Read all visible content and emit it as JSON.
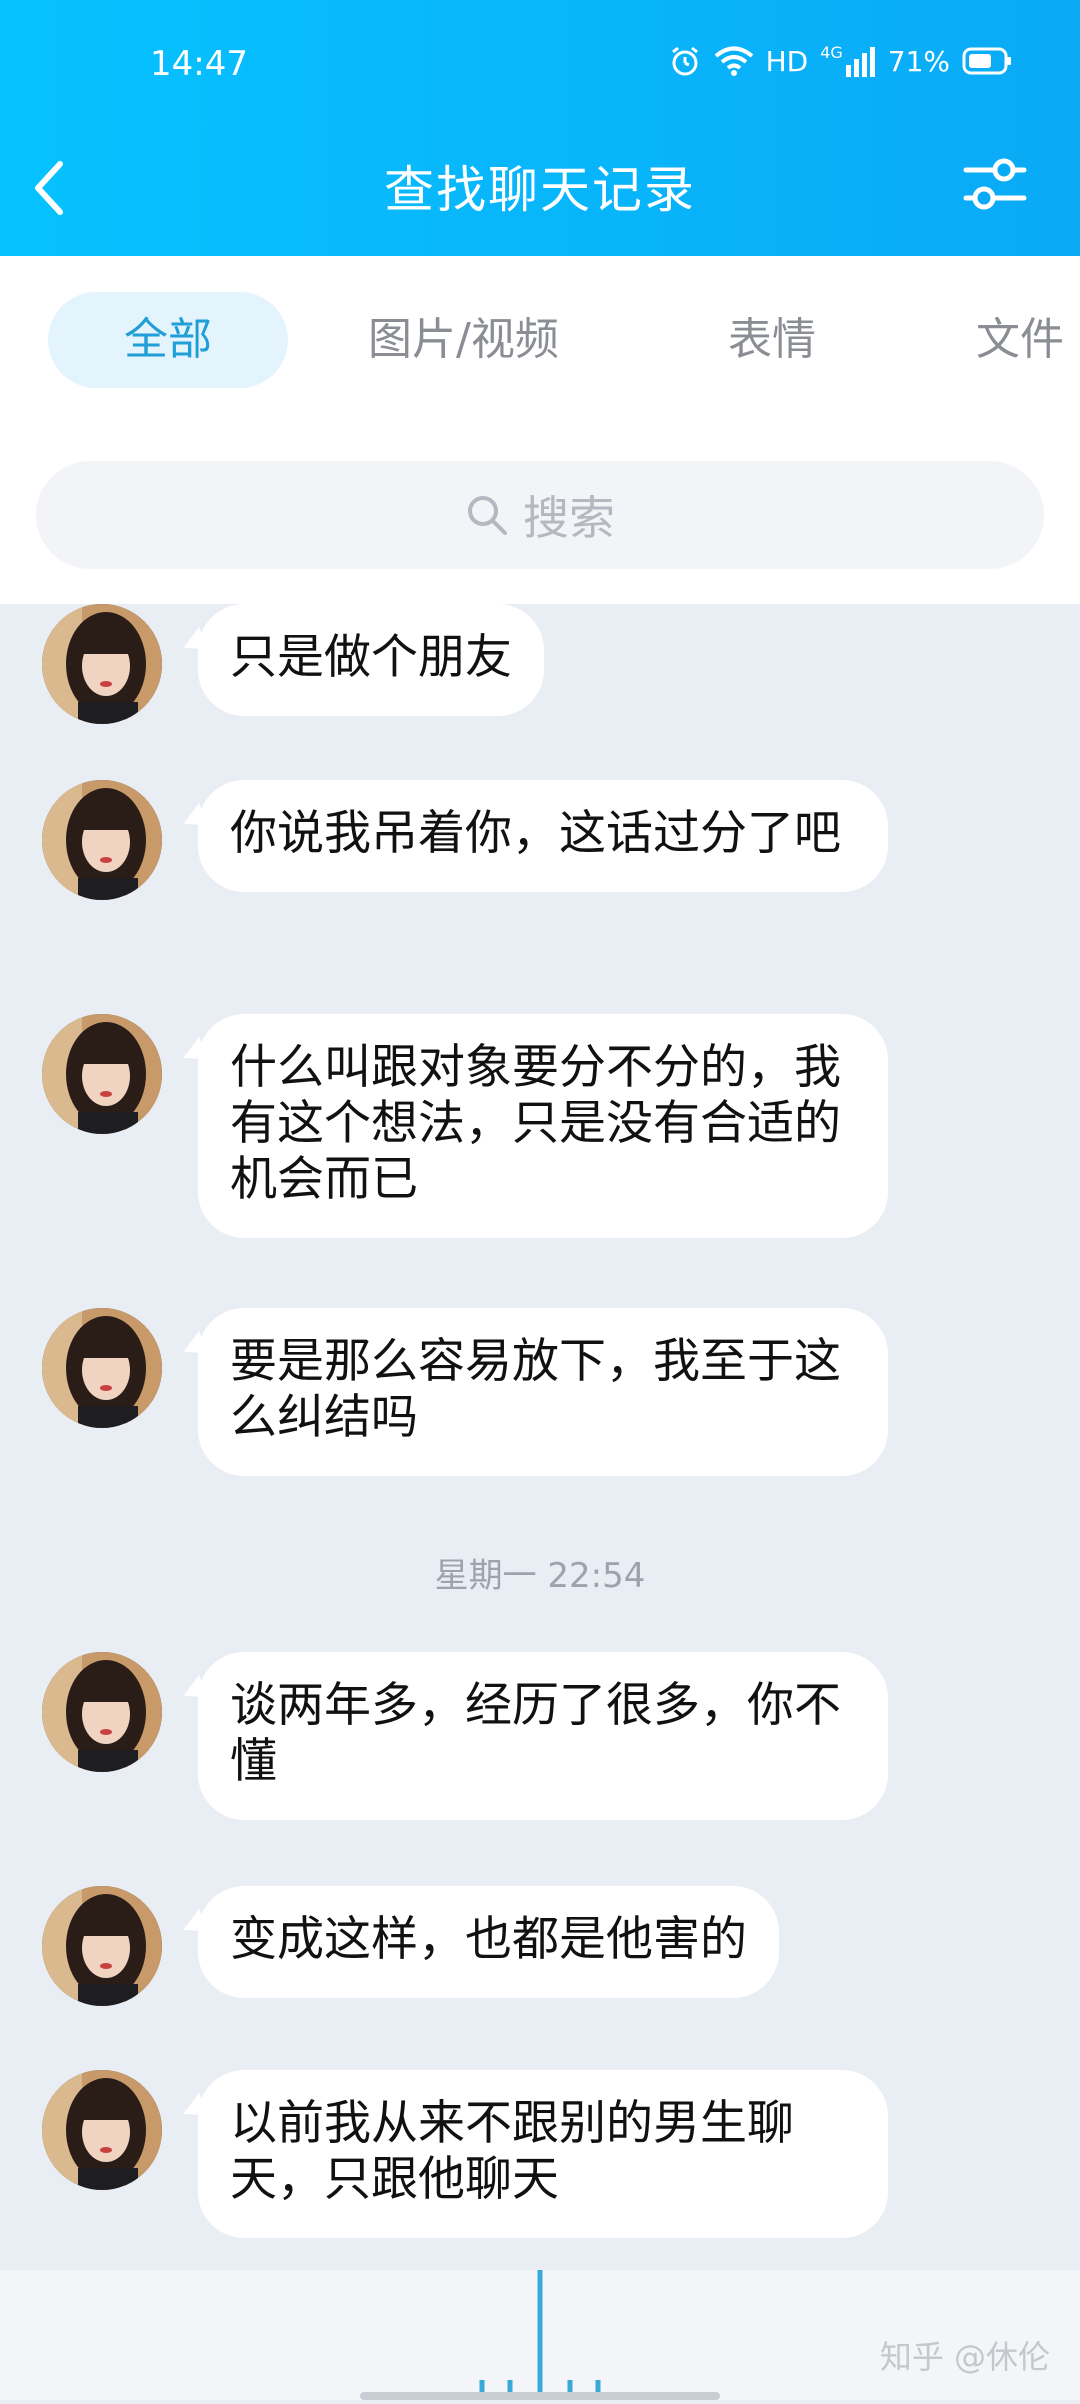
{
  "status_bar": {
    "time": "14:47",
    "hd": "HD",
    "network": "4G",
    "battery": "71%"
  },
  "header": {
    "title": "查找聊天记录"
  },
  "tabs": [
    {
      "label": "全部",
      "active": true
    },
    {
      "label": "图片/视频",
      "active": false
    },
    {
      "label": "表情",
      "active": false
    },
    {
      "label": "文件",
      "active": false
    }
  ],
  "search": {
    "placeholder": "搜索"
  },
  "messages": [
    {
      "text": "只是做个朋友"
    },
    {
      "text": "你说我吊着你，这话过分了吧"
    },
    {
      "text": "什么叫跟对象要分不分的，我有这个想法，只是没有合适的机会而已"
    },
    {
      "text": "要是那么容易放下，我至于这么纠结吗"
    },
    {
      "text": "谈两年多，经历了很多，你不懂"
    },
    {
      "text": "变成这样，也都是他害的"
    },
    {
      "text": "以前我从来不跟别的男生聊天，只跟他聊天"
    }
  ],
  "timestamp": "星期一 22:54",
  "watermark": "知乎 @休伦",
  "colors": {
    "header_start": "#06c2ff",
    "header_end": "#0aaaf6",
    "accent": "#1f9ed8",
    "chat_bg": "#e9edf4"
  }
}
